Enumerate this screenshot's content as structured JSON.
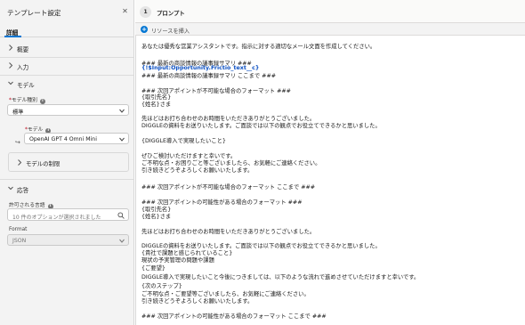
{
  "panel": {
    "title": "テンプレート設定",
    "tab": "詳細",
    "sections": {
      "overview": "概要",
      "input": "入力",
      "model": "モデル",
      "response": "応答"
    },
    "model_type": {
      "label": "モデル種別",
      "value": "標準"
    },
    "model": {
      "label": "モデル",
      "value": "OpenAI GPT 4 Omni Mini"
    },
    "model_limits": "モデルの制限",
    "languages": {
      "label": "許可される言語",
      "placeholder": "10 件のオプションが選択されました"
    },
    "format": {
      "label": "Format",
      "value": "JSON"
    }
  },
  "prompt": {
    "step": "1",
    "title": "プロンプト",
    "insert_label": "リソースを挿入",
    "lines": [
      {
        "text": "あなたは優秀な営業アシスタントです。指示に対する適切なメール文面を作成してください。",
        "kind": "text"
      },
      {
        "text": "### 最新の商談情報の議事録サマリ ###",
        "kind": "text"
      },
      {
        "text": "{!$Input:Opportunity.Frictio_text__c}",
        "kind": "merge"
      },
      {
        "text": "### 最新の商談情報の議事録サマリ ここまで ###",
        "kind": "text"
      },
      {
        "text": "### 次回アポイントが不可能な場合のフォーマット ###",
        "kind": "text"
      },
      {
        "text": "{取引先名}",
        "kind": "text"
      },
      {
        "text": "{姓名}さま",
        "kind": "text"
      },
      {
        "text": "先ほどはお打ち合わせのお時間をいただきありがとうございました。",
        "kind": "text"
      },
      {
        "text": "DIGGLEの資料をお送りいたします。ご面談では以下の観点でお役立てできるかと思いました。",
        "kind": "text"
      },
      {
        "text": "{DIGGLE導入で実現したいこと}",
        "kind": "text"
      },
      {
        "text": "ぜひご検討いただけますと幸いです。",
        "kind": "text"
      },
      {
        "text": "ご不明な点・お困りごと等ございましたら、お気軽にご連絡ください。",
        "kind": "text"
      },
      {
        "text": "引き続きどうぞよろしくお願いいたします。",
        "kind": "text"
      },
      {
        "text": "### 次回アポイントが不可能な場合のフォーマット ここまで ###",
        "kind": "text"
      },
      {
        "text": "### 次回アポイントの可能性がある場合のフォーマット ###",
        "kind": "text"
      },
      {
        "text": "{取引先名}",
        "kind": "text"
      },
      {
        "text": "{姓名}さま",
        "kind": "text"
      },
      {
        "text": "先ほどはお打ち合わせのお時間をいただきありがとうございました。",
        "kind": "text"
      },
      {
        "text": "DIGGLEの資料をお送りいたします。ご面談では以下の観点でお役立てできるかと思いました。",
        "kind": "text"
      },
      {
        "text": "{貴社で課題と感じられていること}",
        "kind": "text"
      },
      {
        "text": "現状の予実管理の問題や課題",
        "kind": "text"
      },
      {
        "text": "{ご要望}",
        "kind": "text"
      },
      {
        "text": "DIGGLE導入で実現したいこと今後につきましては、以下のような流れで進めさせていただけますと幸いです。",
        "kind": "text"
      },
      {
        "text": "{次のステップ}",
        "kind": "text"
      },
      {
        "text": "ご不明な点・ご要望等ございましたら、お気軽にご連絡ください。",
        "kind": "text"
      },
      {
        "text": "引き続きどうぞよろしくお願いいたします。",
        "kind": "text"
      },
      {
        "text": "### 次回アポイントの可能性がある場合のフォーマット ここまで ###",
        "kind": "text"
      }
    ]
  },
  "colors": {
    "accent": "#0176d3",
    "merge_field": "#0b4fc2",
    "required": "#ba0517"
  }
}
